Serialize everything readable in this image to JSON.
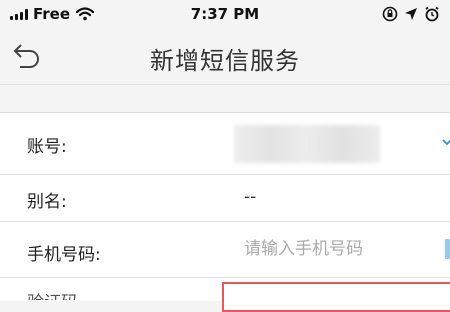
{
  "status_bar": {
    "carrier": "Free",
    "time": "7:37 PM"
  },
  "nav": {
    "title": "新增短信服务"
  },
  "form": {
    "account": {
      "label": "账号:"
    },
    "alias": {
      "label": "别名:",
      "value": "--"
    },
    "phone": {
      "label": "手机号码:",
      "placeholder": "请输入手机号码"
    },
    "next_row_label": "验证码"
  },
  "colors": {
    "highlight": "#e45a5a",
    "dropdown_accent": "#3b8fd6"
  }
}
